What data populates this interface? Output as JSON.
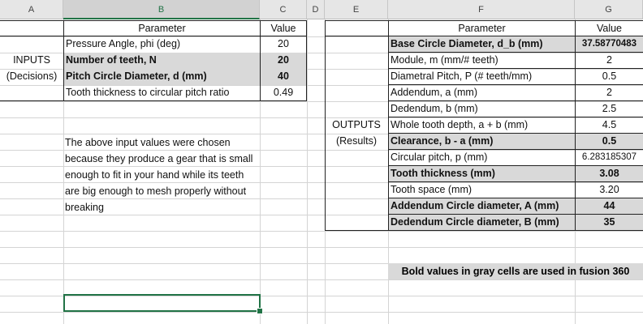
{
  "columns": [
    "A",
    "B",
    "C",
    "D",
    "E",
    "F",
    "G"
  ],
  "left_header": {
    "parameter": "Parameter",
    "value": "Value"
  },
  "inputs_label": "INPUTS",
  "decisions_label": "(Decisions)",
  "inputs": [
    {
      "name": "Pressure Angle, phi (deg)",
      "value": "20",
      "emphasis": false
    },
    {
      "name": "Number of teeth, N",
      "value": "20",
      "emphasis": true
    },
    {
      "name": "Pitch Circle Diameter, d (mm)",
      "value": "40",
      "emphasis": true
    },
    {
      "name": "Tooth thickness to circular pitch ratio",
      "value": "0.49",
      "emphasis": false
    }
  ],
  "note": "The above input values were chosen because they produce a gear that is small enough to fit in your hand while its teeth are big enough to mesh properly without breaking",
  "right_header": {
    "parameter": "Parameter",
    "value": "Value"
  },
  "outputs_label": "OUTPUTS",
  "results_label": "(Results)",
  "outputs": [
    {
      "name": "Base Circle Diameter, d_b (mm)",
      "value": "37.58770483",
      "emphasis": true
    },
    {
      "name": "Module, m (mm/# teeth)",
      "value": "2",
      "emphasis": false
    },
    {
      "name": "Diametral Pitch, P (# teeth/mm)",
      "value": "0.5",
      "emphasis": false
    },
    {
      "name": "Addendum, a (mm)",
      "value": "2",
      "emphasis": false
    },
    {
      "name": "Dedendum, b (mm)",
      "value": "2.5",
      "emphasis": false
    },
    {
      "name": "Whole tooth depth, a + b (mm)",
      "value": "4.5",
      "emphasis": false
    },
    {
      "name": "Clearance, b - a (mm)",
      "value": "0.5",
      "emphasis": true
    },
    {
      "name": "Circular pitch, p (mm)",
      "value": "6.283185307",
      "emphasis": false
    },
    {
      "name": "Tooth thickness (mm)",
      "value": "3.08",
      "emphasis": true
    },
    {
      "name": "Tooth space (mm)",
      "value": "3.20",
      "emphasis": false
    },
    {
      "name": "Addendum Circle diameter, A (mm)",
      "value": "44",
      "emphasis": true
    },
    {
      "name": "Dedendum Circle diameter, B (mm)",
      "value": "35",
      "emphasis": true
    }
  ],
  "banner": "Bold values in gray cells are used in fusion 360",
  "accent_color": "#217346",
  "highlight_color": "#d9d9d9"
}
